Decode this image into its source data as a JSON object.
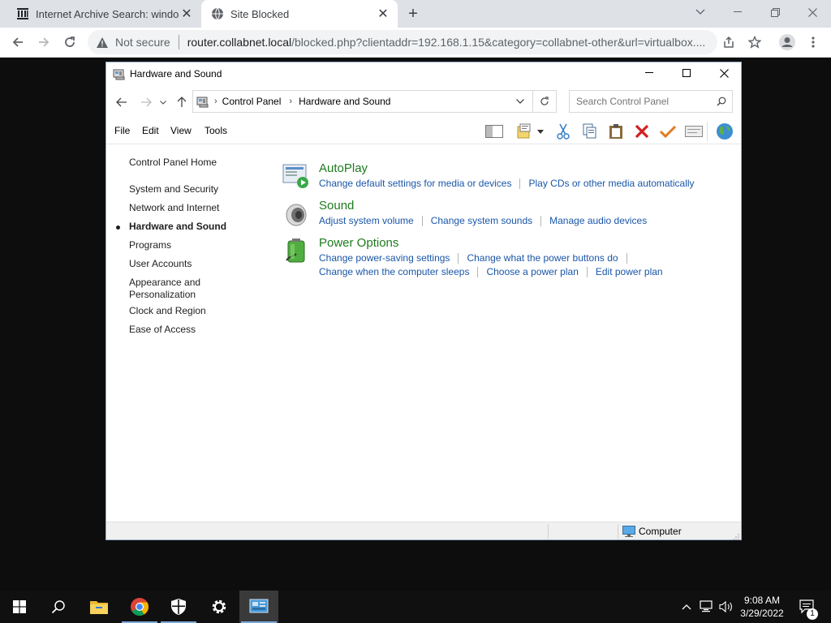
{
  "browser": {
    "tabs": [
      {
        "title": "Internet Archive Search: windows",
        "favicon": "archive-icon",
        "active": false
      },
      {
        "title": "Site Blocked",
        "favicon": "globe-icon",
        "active": true
      }
    ],
    "security_label": "Not secure",
    "url_host": "router.collabnet.local",
    "url_rest": "/blocked.php?clientaddr=192.168.1.15&category=collabnet-other&url=virtualbox...."
  },
  "window": {
    "title": "Hardware and Sound",
    "breadcrumb": [
      "Control Panel",
      "Hardware and Sound"
    ],
    "search_placeholder": "Search Control Panel",
    "menu": [
      "File",
      "Edit",
      "View",
      "Tools"
    ],
    "left_nav": [
      {
        "label": "Control Panel Home",
        "current": false
      },
      {
        "label": "System and Security",
        "current": false
      },
      {
        "label": "Network and Internet",
        "current": false
      },
      {
        "label": "Hardware and Sound",
        "current": true
      },
      {
        "label": "Programs",
        "current": false
      },
      {
        "label": "User Accounts",
        "current": false
      },
      {
        "label": "Appearance and Personalization",
        "current": false
      },
      {
        "label": "Clock and Region",
        "current": false
      },
      {
        "label": "Ease of Access",
        "current": false
      }
    ],
    "categories": [
      {
        "title": "AutoPlay",
        "icon": "autoplay-icon",
        "links": [
          [
            "Change default settings for media or devices",
            "Play CDs or other media automatically"
          ]
        ]
      },
      {
        "title": "Sound",
        "icon": "speaker-icon",
        "links": [
          [
            "Adjust system volume",
            "Change system sounds",
            "Manage audio devices"
          ]
        ]
      },
      {
        "title": "Power Options",
        "icon": "battery-icon",
        "links": [
          [
            "Change power-saving settings",
            "Change what the power buttons do"
          ],
          [
            "Change when the computer sleeps",
            "Choose a power plan",
            "Edit power plan"
          ]
        ]
      }
    ],
    "status_location": "Computer"
  },
  "taskbar": {
    "time": "9:08 AM",
    "date": "3/29/2022",
    "notification_count": "1"
  },
  "colors": {
    "category_title": "#1e7a1e",
    "link": "#1a56a8",
    "taskbar": "#101010"
  }
}
